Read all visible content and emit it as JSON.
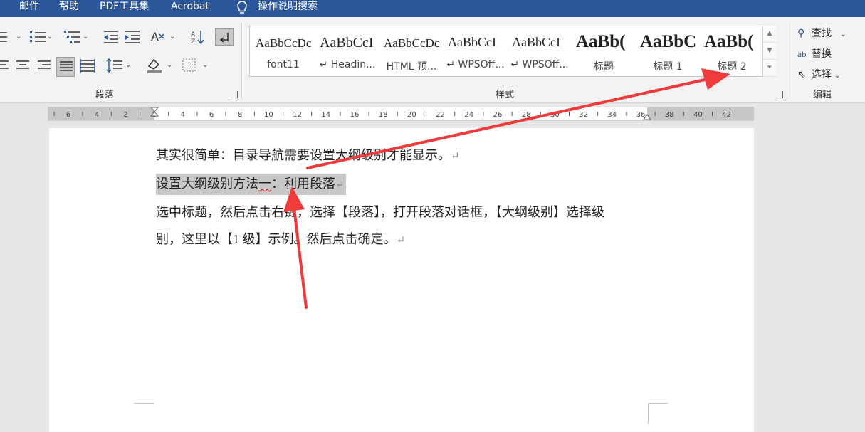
{
  "tabs": [
    "邮件",
    "帮助",
    "PDF工具集",
    "Acrobat"
  ],
  "tell_me": "操作说明搜索",
  "groups": {
    "paragraph": "段落",
    "styles": "样式",
    "editing": "编辑"
  },
  "styles": [
    {
      "preview": "AaBbCcDc",
      "name": "font11"
    },
    {
      "preview": "AaBbCcI",
      "name": "↵ Headin..."
    },
    {
      "preview": "AaBbCcDc",
      "name": "HTML 预..."
    },
    {
      "preview": "AaBbCcI",
      "name": "↵ WPSOff..."
    },
    {
      "preview": "AaBbCcI",
      "name": "↵ WPSOff..."
    },
    {
      "preview": "AaBb(",
      "name": "标题"
    },
    {
      "preview": "AaBbC",
      "name": "标题 1"
    },
    {
      "preview": "AaBb(",
      "name": "标题 2"
    }
  ],
  "editing": {
    "find": "查找",
    "replace": "替换",
    "select": "选择"
  },
  "ruler_labels": [
    "6",
    "4",
    "2",
    "2",
    "4",
    "6",
    "8",
    "10",
    "12",
    "14",
    "16",
    "18",
    "20",
    "22",
    "24",
    "26",
    "28",
    "30",
    "32",
    "34",
    "36",
    "38",
    "40",
    "42"
  ],
  "document": {
    "line1": "其实很简单：目录导航需要设置大纲级别才能显示。",
    "line2_a": "设置大纲级别方法",
    "line2_b": "一",
    "line2_c": "：利用段落",
    "line3": "选中标题，然后点击右键，选择【段落】，打开段落对话框，【大纲级别】选择级",
    "line4": "别，这里以【1 级】示例。然后点击确定。",
    "para_mark": "↵"
  },
  "colors": {
    "ribbon_blue": "#2b579a",
    "arrow_red": "#ef3b3b",
    "highlight_gray": "#c8c8c8"
  }
}
